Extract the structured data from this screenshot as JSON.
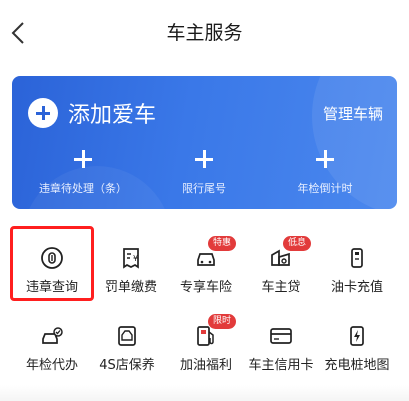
{
  "header": {
    "title": "车主服务",
    "back_icon": "chevron-left-icon"
  },
  "card": {
    "add_car_label": "添加爱车",
    "manage_label": "管理车辆",
    "stats": [
      {
        "label": "违章待处理（条）"
      },
      {
        "label": "限行尾号"
      },
      {
        "label": "年检倒计时"
      }
    ],
    "colors": {
      "gradient_start": "#2b63d8",
      "gradient_end": "#4b88ee"
    }
  },
  "services": [
    {
      "label": "违章查询",
      "icon": "violation-search-icon"
    },
    {
      "label": "罚单缴费",
      "icon": "ticket-payment-icon"
    },
    {
      "label": "专享车险",
      "icon": "car-insurance-icon",
      "badge": "特惠"
    },
    {
      "label": "车主贷",
      "icon": "car-loan-icon",
      "badge": "低息"
    },
    {
      "label": "油卡充值",
      "icon": "fuel-card-icon"
    },
    {
      "label": "年检代办",
      "icon": "inspection-icon"
    },
    {
      "label": "4S店保养",
      "icon": "maintenance-icon"
    },
    {
      "label": "加油福利",
      "icon": "fuel-pump-icon",
      "badge": "限时"
    },
    {
      "label": "车主信用卡",
      "icon": "credit-card-icon"
    },
    {
      "label": "充电桩地图",
      "icon": "charging-station-icon"
    }
  ],
  "highlight_color": "#ff1f1f",
  "badge_color": "#e23b3b"
}
